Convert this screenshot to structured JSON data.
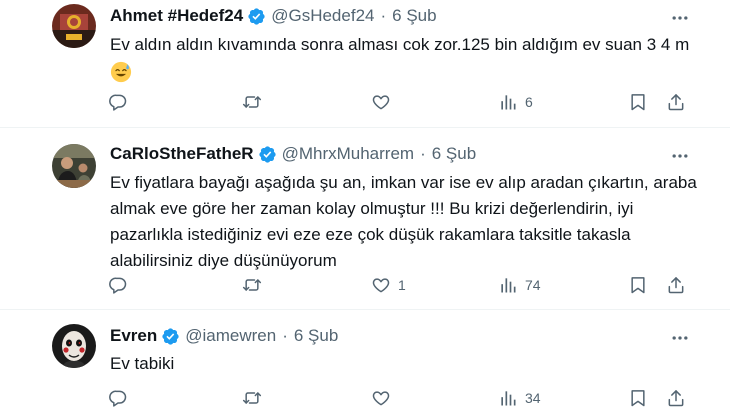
{
  "tweets": [
    {
      "name": "Ahmet #Hedef24",
      "handle": "@GsHedef24",
      "separator": "·",
      "time": "6 Şub",
      "text": "Ev aldın aldın kıvamında sonra alması cok zor.125 bin aldığım ev suan 3 4 m",
      "emoji": "sweat-smile-emoji",
      "replies": "",
      "retweets": "",
      "likes": "",
      "views": "6"
    },
    {
      "name": "CaRloStheFatheR",
      "handle": "@MhrxMuharrem",
      "separator": "·",
      "time": "6 Şub",
      "text": "Ev fiyatlara bayağı aşağıda şu an, imkan var ise ev alıp aradan çıkartın, araba almak eve göre her zaman kolay olmuştur !!! Bu krizi değerlendirin, iyi pazarlıkla istediğiniz evi eze eze çok düşük rakamlara taksitle takasla alabilirsiniz diye düşünüyorum",
      "replies": "",
      "retweets": "",
      "likes": "1",
      "views": "74"
    },
    {
      "name": "Evren",
      "handle": "@iamewren",
      "separator": "·",
      "time": "6 Şub",
      "text": "Ev tabiki",
      "replies": "",
      "retweets": "",
      "likes": "",
      "views": "34"
    }
  ],
  "colors": {
    "text": "#0f1419",
    "secondary": "#536471",
    "verified": "#1d9bf0",
    "divider": "#eff3f4"
  },
  "icons": [
    "verified-badge-icon",
    "more-icon",
    "reply-icon",
    "retweet-icon",
    "like-icon",
    "views-icon",
    "bookmark-icon",
    "share-icon"
  ]
}
